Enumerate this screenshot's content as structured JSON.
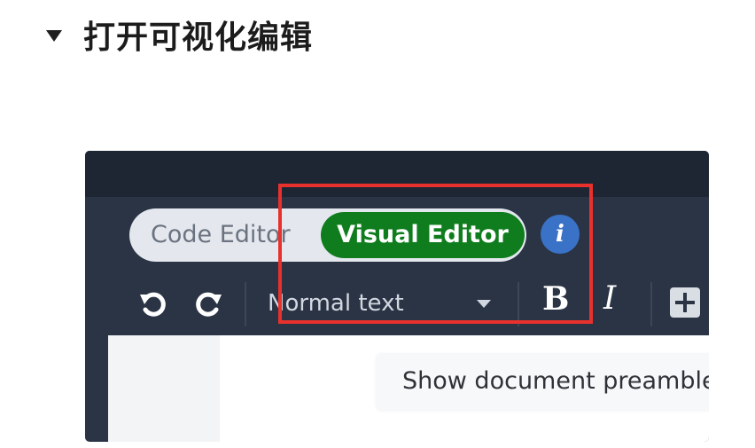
{
  "heading": {
    "title": "打开可视化编辑"
  },
  "editor_mode": {
    "code_editor_label": "Code Editor",
    "visual_editor_label": "Visual Editor",
    "active": "Visual Editor",
    "active_color": "#0f7d1e",
    "info_icon": "info-icon"
  },
  "toolbar": {
    "style_select": "Normal text",
    "bold_label": "B",
    "italic_label": "I",
    "icons": [
      "undo-icon",
      "redo-icon",
      "table-icon"
    ]
  },
  "document": {
    "preamble_label": "Show document preamble"
  },
  "colors": {
    "highlight": "#e8312c",
    "toolbar_bg": "#2a3445",
    "info": "#3a72c7"
  }
}
